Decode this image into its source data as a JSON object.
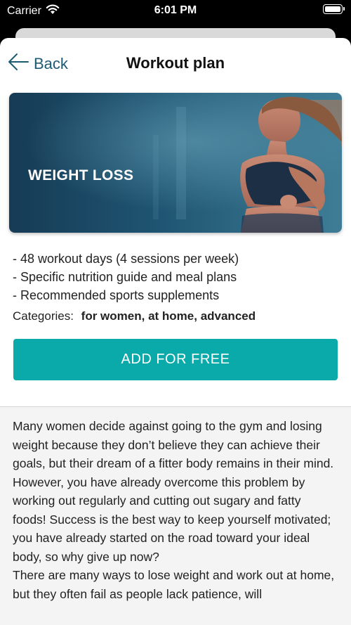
{
  "status_bar": {
    "carrier": "Carrier",
    "time": "6:01 PM",
    "icons": [
      "wifi-icon",
      "battery-icon"
    ]
  },
  "nav": {
    "back_label": "Back",
    "title": "Workout plan",
    "back_icon": "arrow-left-icon",
    "accent_color": "#1f5a73"
  },
  "plan": {
    "hero_title": "WEIGHT LOSS",
    "features": [
      "- 48 workout days (4 sessions per week)",
      "- Specific nutrition guide and meal plans",
      "- Recommended sports supplements"
    ],
    "categories_label": "Categories:",
    "categories_value": "for women, at home, advanced",
    "add_button_label": "ADD FOR FREE",
    "add_button_color": "#0aa9aa"
  },
  "description": {
    "paragraphs": [
      "Many women decide against going to the gym and losing weight because they don’t believe they can achieve their goals, but their dream of a fitter body remains in their mind. However, you have already overcome this problem by working out regularly and cutting out sugary and fatty foods! Success is the best way to keep yourself motivated; you have already started on the road toward your ideal body, so why give up now?",
      "There are many ways to lose weight and work out at home, but they often fail as people lack patience, will"
    ]
  }
}
